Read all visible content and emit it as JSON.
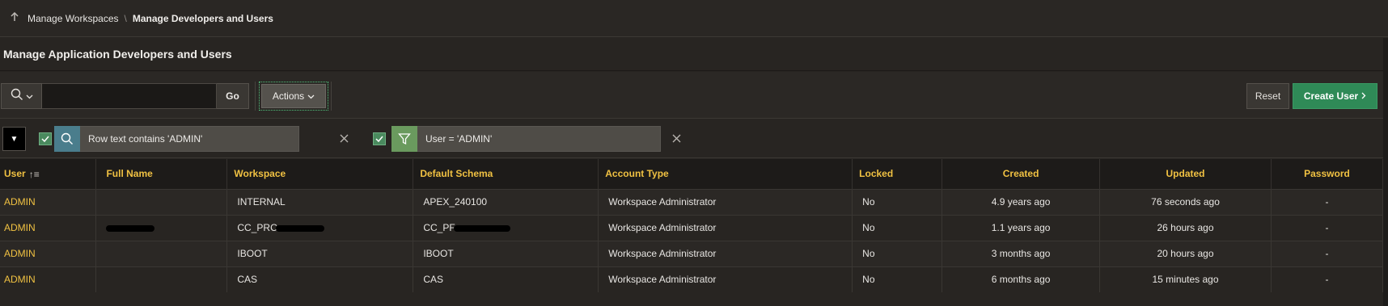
{
  "breadcrumb": {
    "parent": "Manage Workspaces",
    "separator": "\\",
    "current": "Manage Developers and Users"
  },
  "region": {
    "title": "Manage Application Developers and Users"
  },
  "toolbar": {
    "search_value": "",
    "go_label": "Go",
    "actions_label": "Actions",
    "reset_label": "Reset",
    "create_label": "Create User"
  },
  "filters": [
    {
      "text": "Row text contains 'ADMIN'",
      "icon": "search-icon",
      "color": "#4a7d8c",
      "enabled": true
    },
    {
      "text": "User = 'ADMIN'",
      "icon": "filter-icon",
      "color": "#6a9a5e",
      "enabled": true
    }
  ],
  "table": {
    "columns": [
      "User",
      "Full Name",
      "Workspace",
      "Default Schema",
      "Account Type",
      "Locked",
      "Created",
      "Updated",
      "Password"
    ],
    "rows": [
      {
        "user": "ADMIN",
        "full_name": "",
        "workspace": "INTERNAL",
        "schema": "APEX_240100",
        "account_type": "Workspace Administrator",
        "locked": "No",
        "created": "4.9 years ago",
        "updated": "76 seconds ago",
        "password": "-"
      },
      {
        "user": "ADMIN",
        "full_name": "",
        "workspace": "CC_PRC",
        "schema": "CC_PF",
        "account_type": "Workspace Administrator",
        "locked": "No",
        "created": "1.1 years ago",
        "updated": "26 hours ago",
        "password": "-"
      },
      {
        "user": "ADMIN",
        "full_name": "",
        "workspace": "IBOOT",
        "schema": "IBOOT",
        "account_type": "Workspace Administrator",
        "locked": "No",
        "created": "3 months ago",
        "updated": "20 hours ago",
        "password": "-"
      },
      {
        "user": "ADMIN",
        "full_name": "",
        "workspace": "CAS",
        "schema": "CAS",
        "account_type": "Workspace Administrator",
        "locked": "No",
        "created": "6 months ago",
        "updated": "15 minutes ago",
        "password": "-"
      }
    ]
  },
  "colors": {
    "accent_gold": "#f0c142",
    "create_green": "#2f8a57",
    "background": "#282522"
  }
}
